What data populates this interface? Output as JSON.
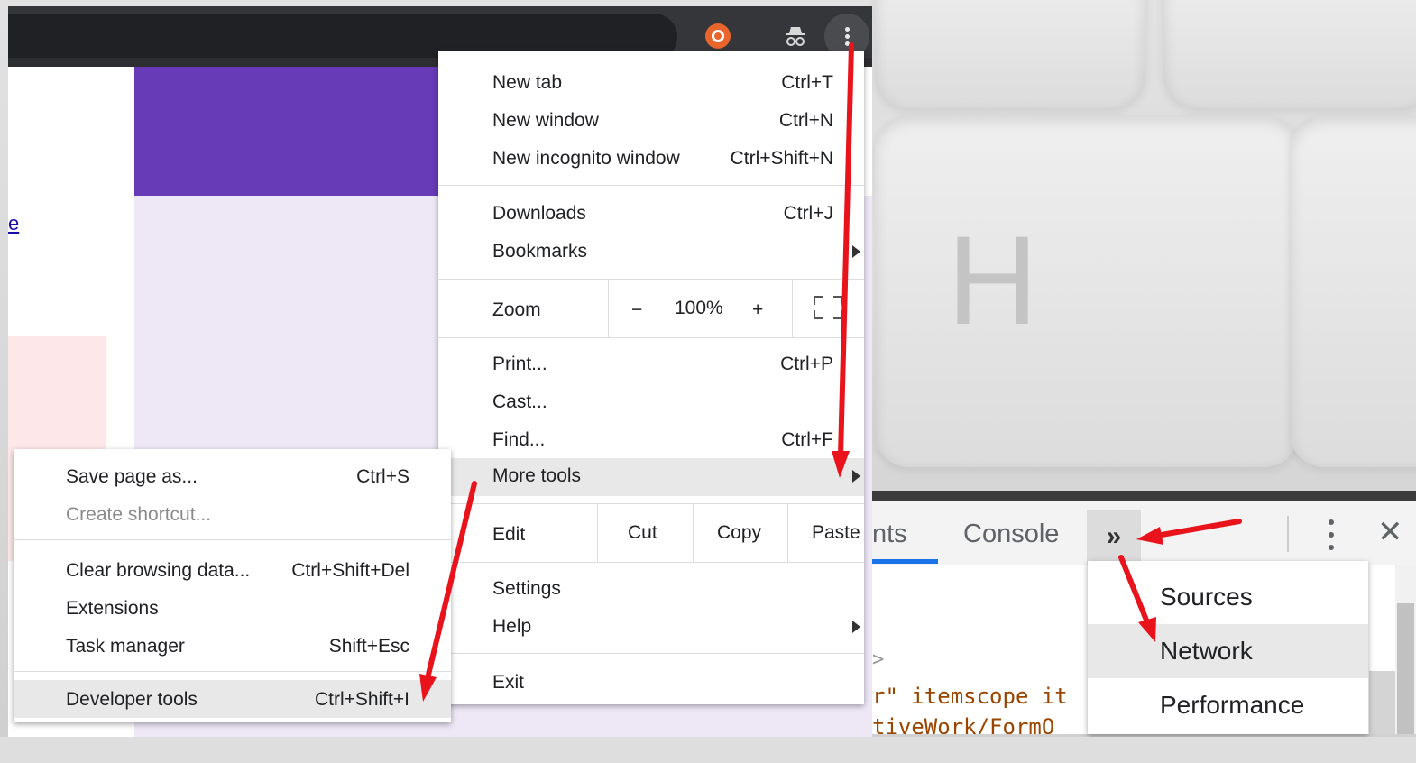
{
  "main_menu": {
    "items": [
      {
        "label": "New tab",
        "shortcut": "Ctrl+T"
      },
      {
        "label": "New window",
        "shortcut": "Ctrl+N"
      },
      {
        "label": "New incognito window",
        "shortcut": "Ctrl+Shift+N"
      },
      {
        "label": "Downloads",
        "shortcut": "Ctrl+J"
      },
      {
        "label": "Bookmarks",
        "shortcut": ""
      },
      {
        "label": "Print...",
        "shortcut": "Ctrl+P"
      },
      {
        "label": "Cast...",
        "shortcut": ""
      },
      {
        "label": "Find...",
        "shortcut": "Ctrl+F"
      },
      {
        "label": "More tools",
        "shortcut": ""
      },
      {
        "label": "Settings",
        "shortcut": ""
      },
      {
        "label": "Help",
        "shortcut": ""
      },
      {
        "label": "Exit",
        "shortcut": ""
      }
    ],
    "zoom": {
      "label": "Zoom",
      "minus": "−",
      "value": "100%",
      "plus": "+"
    },
    "edit": {
      "label": "Edit",
      "cut": "Cut",
      "copy": "Copy",
      "paste": "Paste"
    }
  },
  "more_tools_menu": {
    "items": [
      {
        "label": "Save page as...",
        "shortcut": "Ctrl+S"
      },
      {
        "label": "Create shortcut...",
        "shortcut": ""
      },
      {
        "label": "Clear browsing data...",
        "shortcut": "Ctrl+Shift+Del"
      },
      {
        "label": "Extensions",
        "shortcut": ""
      },
      {
        "label": "Task manager",
        "shortcut": "Shift+Esc"
      },
      {
        "label": "Developer tools",
        "shortcut": "Ctrl+Shift+I"
      }
    ]
  },
  "page": {
    "link_fragment": "e"
  },
  "devtools": {
    "tabs": {
      "elements_fragment": "nts",
      "console": "Console",
      "more": "»"
    },
    "close": "✕",
    "code_lines": [
      "r\" itemscope it",
      "tiveWork/FormO"
    ],
    "caret": ">",
    "overflow_menu": [
      "Sources",
      "Network",
      "Performance"
    ]
  },
  "keyboard_letter": "H",
  "colors": {
    "accent": "#1a73e8",
    "purple": "#673ab7",
    "lavender": "#ede7f6",
    "arrow": "#e8131b",
    "toolbar": "#35363a"
  },
  "icons": [
    "extension-icon",
    "incognito-icon",
    "kebab-menu-icon",
    "fullscreen-icon",
    "chevron-right-icon",
    "close-icon"
  ]
}
